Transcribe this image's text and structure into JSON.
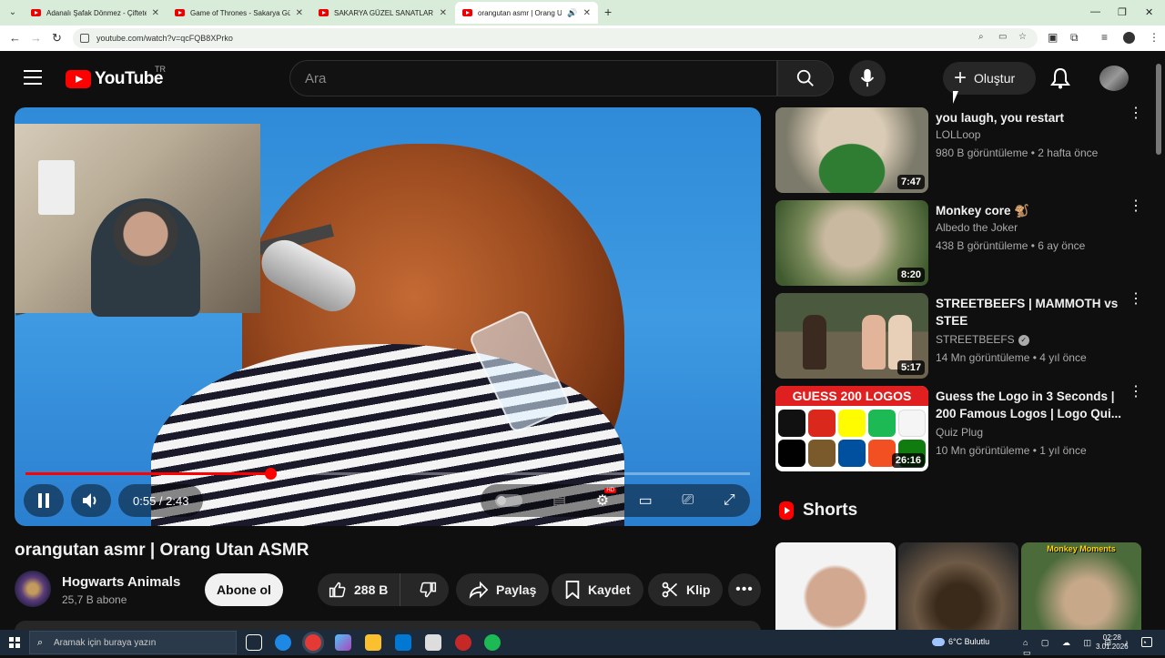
{
  "browser": {
    "tabs": [
      {
        "title": "Adanalı Şafak Dönmez - Çiftetelli"
      },
      {
        "title": "Game of Thrones - Sakarya Güzel"
      },
      {
        "title": "SAKARYA GÜZEL SANATLAR LİSESİ"
      },
      {
        "title": "orangutan asmr | Orang Utan ASMR",
        "active": true
      }
    ],
    "url": "youtube.com/watch?v=qcFQB8XPrko"
  },
  "header": {
    "logo_text": "YouTube",
    "region": "TR",
    "search_placeholder": "Ara",
    "create_label": "Oluştur"
  },
  "player": {
    "current_time": "0:55",
    "duration": "2:43",
    "time_display": "0:55 / 2:43",
    "progress": 0.3376,
    "hd_badge": "HD"
  },
  "video": {
    "title": "orangutan asmr | Orang Utan ASMR",
    "channel": "Hogwarts Animals",
    "subscribers": "25,7 B abone",
    "subscribe_label": "Abone ol",
    "likes": "288 B",
    "share_label": "Paylaş",
    "save_label": "Kaydet",
    "clip_label": "Klip"
  },
  "recommendations": [
    {
      "title": "you laugh, you restart",
      "channel": "LOLLoop",
      "meta": "980 B görüntüleme • 2 hafta önce",
      "duration": "7:47"
    },
    {
      "title": "Monkey core 🐒",
      "channel": "Albedo the Joker",
      "meta": "438 B görüntüleme • 6 ay önce",
      "duration": "8:20"
    },
    {
      "title": "STREETBEEFS | MAMMOTH vs STEE",
      "channel": "STREETBEEFS",
      "verified": true,
      "meta": "14 Mn görüntüleme • 4 yıl önce",
      "duration": "5:17"
    },
    {
      "title": "Guess the Logo in 3 Seconds | 200 Famous Logos | Logo Qui...",
      "channel": "Quiz Plug",
      "meta": "10 Mn görüntüleme • 1 yıl önce",
      "duration": "26:16",
      "thumb_text": "GUESS 200 LOGOS"
    }
  ],
  "shorts": {
    "heading": "Shorts",
    "items": [
      {
        "label": ""
      },
      {
        "label": ""
      },
      {
        "label": "Monkey Moments"
      }
    ]
  },
  "taskbar": {
    "search_placeholder": "Aramak için buraya yazın",
    "weather": "6°C  Bulutlu",
    "time": "02:28",
    "date": "3.01.2026"
  }
}
